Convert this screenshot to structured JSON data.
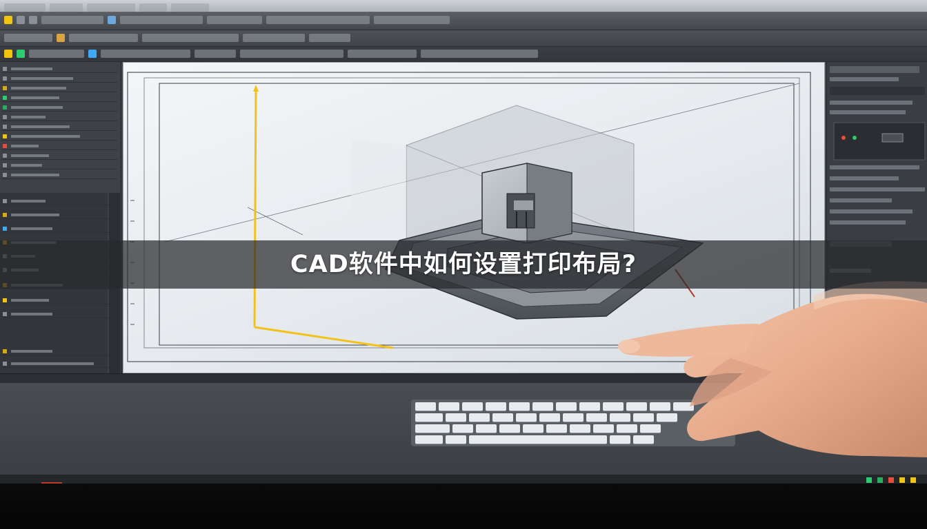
{
  "caption": {
    "title": "CAD软件中如何设置打印布局?"
  },
  "colors": {
    "banner_background": "#28292d",
    "banner_text": "#ffffff",
    "axis_highlight": "#f2c21b",
    "viewport_background": "#eef1f4",
    "ui_dark": "#3e4247"
  },
  "scene": {
    "subject": "cad-workstation-screen",
    "icons": [
      "hand-pointer",
      "keyboard",
      "3d-model-wireframe"
    ]
  }
}
